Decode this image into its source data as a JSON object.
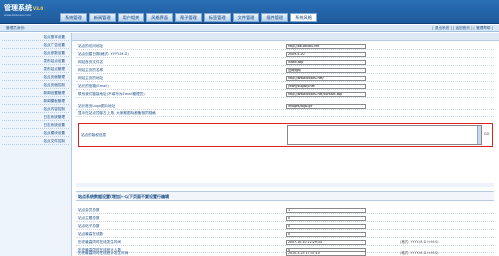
{
  "app": {
    "title": "管理系统",
    "version": "V3.0",
    "subtitle": "www.bzaowu.com"
  },
  "nav": {
    "tabs": [
      "系统管理",
      "新闻管理",
      "用户相关",
      "风格界面",
      "帮子管理",
      "标签管理",
      "文件管理",
      "插件管理",
      "系统风格"
    ]
  },
  "header": {
    "welcome": "管理员身份:",
    "links": "[ 退出系统 ] [ 返回首页 ] [ 管理帮助 ]"
  },
  "sidebar": {
    "items": [
      "站点基本设置",
      "站点广告设置",
      "站点参数设置",
      "发布站点设置",
      "发布站点管理",
      "站点页面管理",
      "站点页面控制",
      "新闻设置管理",
      "新闻模板管理",
      "站点内容控制",
      "日志系统管理",
      "日志系统设置",
      "站点模块设置",
      "站点文件控制"
    ]
  },
  "form": {
    "rows": [
      {
        "label": "站点的访问地址",
        "value": "http://bb.864bu.net",
        "hint": ""
      },
      {
        "label": "站点创建日期(格式: YYYY-M-D)",
        "value": "2009-5-20",
        "hint": ""
      },
      {
        "label": "网站首页文件名",
        "value": "index.asp",
        "hint": ""
      },
      {
        "label": "网站主页的名称",
        "value": "旧网络网",
        "hint": ""
      },
      {
        "label": "网站主页的地址",
        "value": "http://www.864bu.net/",
        "hint": ""
      },
      {
        "label": "站长的信箱(Email)",
        "value": "yew@bugsky.net",
        "hint": ""
      },
      {
        "label": "联系我们链接地址(不填写为Email管理员)",
        "value": "http://www.864bu.net/contact.asp",
        "hint": ""
      },
      {
        "label": "站长首页Logo图片地址",
        "value": "images/logo.gif",
        "hint": ""
      },
      {
        "label": "显示在站点顶部左上角, 大家都图标都备相同规格",
        "value": "",
        "hint": ""
      }
    ],
    "textarea": {
      "label": "站点的版权信息",
      "value": "",
      "go": "GO"
    },
    "section2": {
      "title": "站点系统数据设置(增加)--以下页面不要设置行编辑"
    },
    "rows2": [
      {
        "label": "站点会员总数",
        "value": "1",
        "hint": ""
      },
      {
        "label": "站点主题总数",
        "value": "0",
        "hint": ""
      },
      {
        "label": "站点帖子总数",
        "value": "0",
        "hint": ""
      },
      {
        "label": "站点最高在线数",
        "value": "0",
        "hint": ""
      },
      {
        "label": "历史最高同时在线发生时间",
        "value": "2007-10-10 22:29:34",
        "hint": "(格式: YYYY-M-D H:M:S)"
      },
      {
        "label": "历史最高同时在线统计人数",
        "value": "0",
        "hint": ""
      },
      {
        "label": "历史最高同时在线统计发生时间",
        "value": "2010-3-23 17:37:10",
        "hint": "(格式: YYYY-M-D H:M:S)"
      }
    ]
  }
}
